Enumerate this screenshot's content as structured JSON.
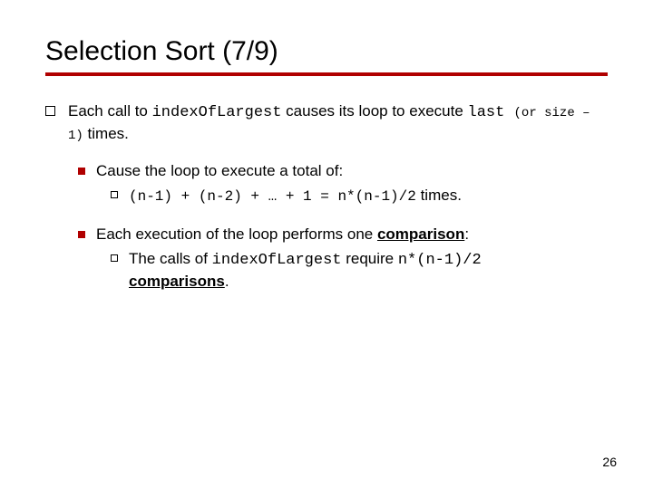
{
  "slide": {
    "title": "Selection Sort (7/9)",
    "main": {
      "prefix": "Each call to ",
      "code1": "indexOfLargest",
      "mid1": " causes its loop to execute ",
      "code2": "last ",
      "paren": "(or size – 1)",
      "suffix": " times."
    },
    "sub1_text": "Cause the loop to execute a total of:",
    "sub1_detail": {
      "expr": "(n-1) + (n-2) + … + 1 = n*(n-1)/2",
      "suffix": "  times."
    },
    "sub2": {
      "line1": "Each execution of the loop performs one ",
      "comp_word": "comparison",
      "colon": ":"
    },
    "sub2_detail": {
      "prefix": "The calls of ",
      "code": "indexOfLargest",
      "mid": " require ",
      "expr": "n*(n-1)/2",
      "newline_word": "comparisons",
      "dot": "."
    },
    "page": "26"
  }
}
